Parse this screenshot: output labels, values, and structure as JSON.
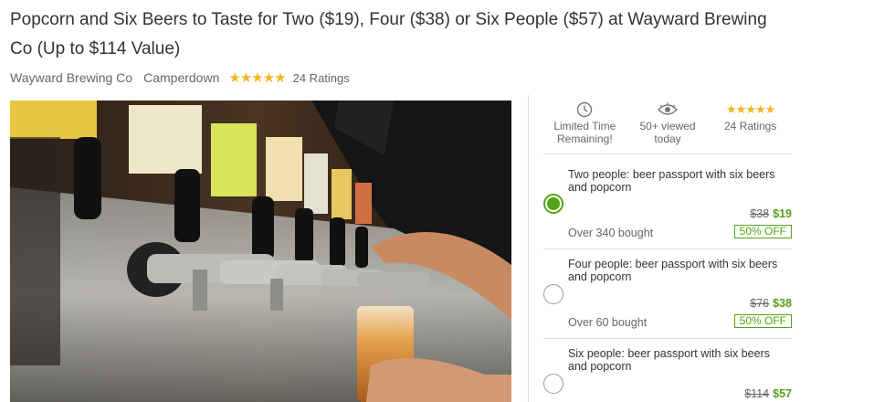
{
  "deal": {
    "title": "Popcorn and Six Beers to Taste for Two ($19), Four ($38) or Six People ($57) at Wayward Brewing Co (Up to $114 Value)",
    "merchant": "Wayward Brewing Co",
    "location": "Camperdown",
    "stars": "★★★★★",
    "ratings": "24 Ratings"
  },
  "badges": {
    "time_line1": "Limited Time",
    "time_line2": "Remaining!",
    "viewed_line1": "50+ viewed",
    "viewed_line2": "today",
    "stars": "★★★★★",
    "ratings": "24 Ratings"
  },
  "options": [
    {
      "name": "Two people: beer passport with six beers and popcorn",
      "original_price": "$38",
      "price": "$19",
      "bought": "Over 340 bought",
      "discount": "50% OFF",
      "selected": true
    },
    {
      "name": "Four people: beer passport with six beers and popcorn",
      "original_price": "$76",
      "price": "$38",
      "bought": "Over 60 bought",
      "discount": "50% OFF",
      "selected": false
    },
    {
      "name": "Six people: beer passport with six beers and popcorn",
      "original_price": "$114",
      "price": "$57",
      "selected": false
    }
  ],
  "colors": {
    "accent_green": "#53a318",
    "star_gold": "#f5b41e"
  },
  "icons": {
    "time": "clock-icon",
    "viewed": "eye-icon"
  }
}
